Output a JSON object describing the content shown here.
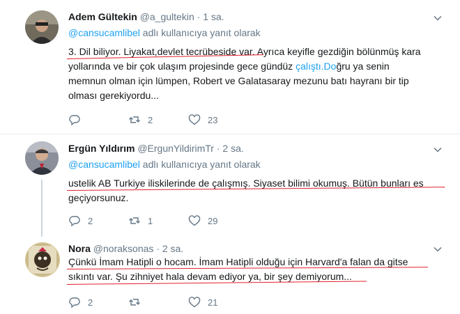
{
  "tweets": [
    {
      "name": "Adem Gültekin",
      "handle": "@a_gultekin",
      "dot": "·",
      "time": "1 sa.",
      "reply_mention": "@cansucamlibel",
      "reply_suffix": " adlı kullanıcıya yanıt olarak",
      "line1": "3. Dil biliyor. Liyakat,devlet tecrübeside var. Ayrıca keyifle gezdiğin bölünmüş kara",
      "line2_pre": "yollarında ve bir çok ulaşım projesinde gece gündüz ",
      "line2_link": "çalıştı.Do",
      "line2_post": "ğru ya senin",
      "line3": "memnun olman için lümpen, Robert ve Galatasaray mezunu batı hayranı bir tip",
      "line4": "olması gerekiyordu...",
      "replies": "",
      "retweets": "2",
      "likes": "23"
    },
    {
      "name": "Ergün Yıldırım",
      "handle": "@ErgunYildirimTr",
      "dot": "·",
      "time": "2 sa.",
      "reply_mention": "@cansucamlibel",
      "reply_suffix": " adlı kullanıcıya yanıt olarak",
      "line1": "ustelik AB Turkiye iliskilerinde de çalışmış. Siyaset bilimi okumuş. Bütün bunları es",
      "line2": "geçiyorsunuz.",
      "replies": "2",
      "retweets": "1",
      "likes": "29"
    },
    {
      "name": "Nora",
      "handle": "@noraksonas",
      "dot": "·",
      "time": "2 sa.",
      "line1": "Çünkü İmam Hatipli o hocam. İmam Hatipli olduğu için Harvard'a falan da gitse",
      "line2": "sıkıntı var. Şu zihniyet hala devam ediyor ya, bir şey demiyorum...",
      "replies": "2",
      "retweets": "",
      "likes": "21"
    }
  ],
  "colors": {
    "accent": "#1da1f2",
    "muted": "#657786",
    "annotation": "#e0202a"
  },
  "icons": [
    "reply-icon",
    "retweet-icon",
    "like-icon",
    "more-caret-icon"
  ]
}
